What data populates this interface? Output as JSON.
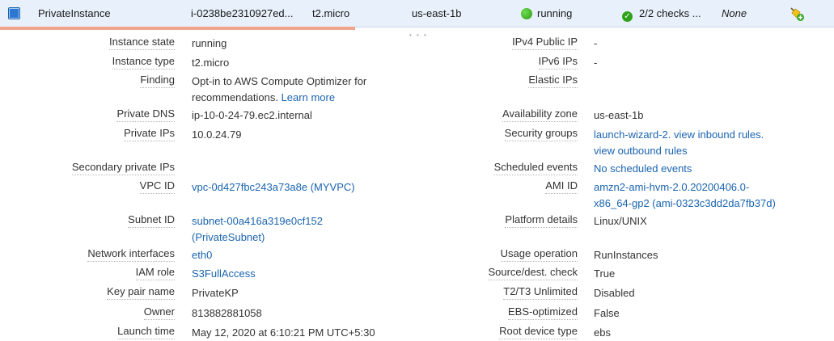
{
  "instance": {
    "name": "PrivateInstance",
    "id": "i-0238be2310927ed...",
    "type": "t2.micro",
    "az": "us-east-1b",
    "state": "running",
    "checks": "2/2 checks ...",
    "alarm": "None",
    "status_color": "#2c9b12"
  },
  "details": [
    {
      "label": "Instance state",
      "lines": [
        "running"
      ]
    },
    {
      "label": "Instance type",
      "lines": [
        "t2.micro"
      ]
    },
    {
      "label": "Finding",
      "lines": [
        "Opt-in to AWS Compute Optimizer for",
        "recommendations."
      ],
      "link": "Learn more"
    },
    {
      "label": "Private DNS",
      "lines": [
        "ip-10-0-24-79.ec2.internal"
      ]
    },
    {
      "label": "Private IPs",
      "lines": [
        "10.0.24.79"
      ]
    },
    {
      "label": "Secondary private IPs",
      "lines": []
    },
    {
      "label": "VPC ID",
      "links": [
        "vpc-0d427fbc243a73a8e (MYVPC)"
      ]
    },
    {
      "label": "Subnet ID",
      "links": [
        "subnet-00a416a319e0cf152",
        "(PrivateSubnet)"
      ]
    },
    {
      "label": "Network interfaces",
      "links": [
        "eth0"
      ]
    },
    {
      "label": "IAM role",
      "links": [
        "S3FullAccess"
      ]
    },
    {
      "label": "Key pair name",
      "lines": [
        "PrivateKP"
      ]
    },
    {
      "label": "Owner",
      "lines": [
        "813882881058"
      ]
    },
    {
      "label": "Launch time",
      "lines": [
        "May 12, 2020 at 6:10:21 PM UTC+5:30"
      ]
    }
  ],
  "details_right": [
    {
      "label": "IPv4 Public IP",
      "lines": [
        "-"
      ]
    },
    {
      "label": "IPv6 IPs",
      "lines": [
        "-"
      ]
    },
    {
      "label": "Elastic IPs",
      "lines": []
    },
    {
      "label": "Availability zone",
      "lines": [
        "us-east-1b"
      ]
    },
    {
      "label": "Security groups",
      "links": [
        "launch-wizard-2. view inbound rules.",
        "view outbound rules"
      ]
    },
    {
      "label": "Scheduled events",
      "links": [
        "No scheduled events"
      ]
    },
    {
      "label": "AMI ID",
      "links": [
        "amzn2-ami-hvm-2.0.20200406.0-",
        "x86_64-gp2 (ami-0323c3dd2da7fb37d)"
      ]
    },
    {
      "label": "Platform details",
      "lines": [
        "Linux/UNIX"
      ]
    },
    {
      "label": "Usage operation",
      "lines": [
        "RunInstances"
      ]
    },
    {
      "label": "Source/dest. check",
      "lines": [
        "True"
      ]
    },
    {
      "label": "T2/T3 Unlimited",
      "lines": [
        "Disabled"
      ]
    },
    {
      "label": "EBS-optimized",
      "lines": [
        "False"
      ]
    },
    {
      "label": "Root device type",
      "lines": [
        "ebs"
      ]
    }
  ]
}
